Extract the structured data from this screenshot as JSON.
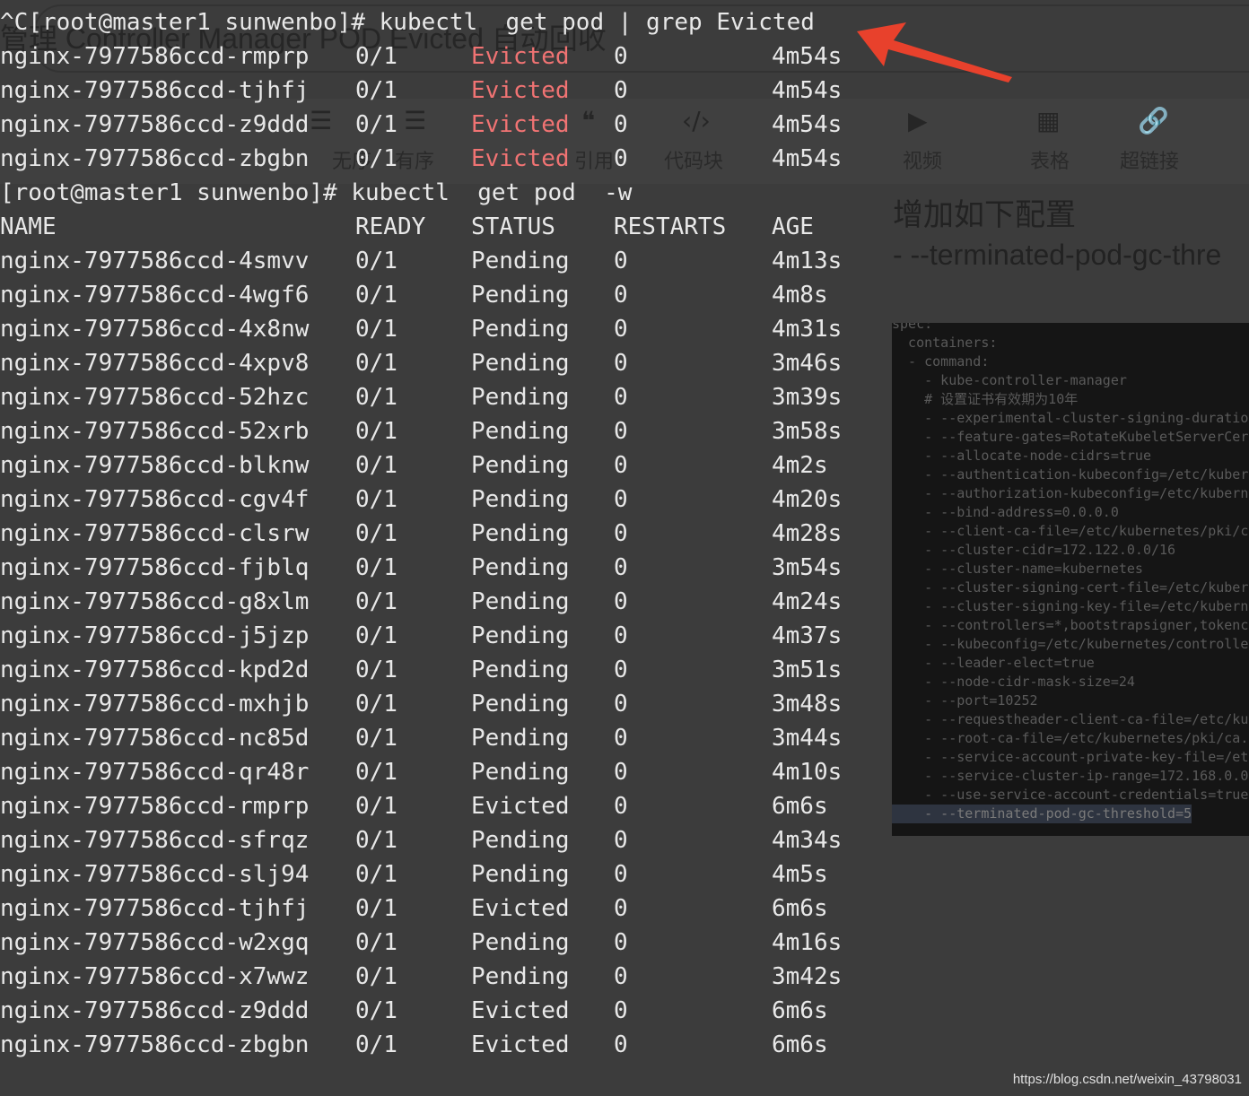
{
  "background": {
    "title": "管理 Controller Manager POD Evicted 自动回收",
    "toolbar": [
      "无序",
      "有序",
      "引用",
      "代码块",
      "视频",
      "表格",
      "超链接"
    ],
    "right_heading": "增加如下配置",
    "right_item": "- --terminated-pod-gc-thre"
  },
  "terminal": {
    "cmd1": "^C[root@master1 sunwenbo]# kubectl  get pod | grep Evicted",
    "grep_rows": [
      [
        "nginx-7977586ccd-rmprp",
        "0/1",
        "Evicted",
        "0",
        "4m54s"
      ],
      [
        "nginx-7977586ccd-tjhfj",
        "0/1",
        "Evicted",
        "0",
        "4m54s"
      ],
      [
        "nginx-7977586ccd-z9ddd",
        "0/1",
        "Evicted",
        "0",
        "4m54s"
      ],
      [
        "nginx-7977586ccd-zbgbn",
        "0/1",
        "Evicted",
        "0",
        "4m54s"
      ]
    ],
    "cmd2": "[root@master1 sunwenbo]# kubectl  get pod  -w",
    "headers": [
      "NAME",
      "READY",
      "STATUS",
      "RESTARTS",
      "AGE"
    ],
    "rows": [
      [
        "nginx-7977586ccd-4smvv",
        "0/1",
        "Pending",
        "0",
        "4m13s"
      ],
      [
        "nginx-7977586ccd-4wgf6",
        "0/1",
        "Pending",
        "0",
        "4m8s"
      ],
      [
        "nginx-7977586ccd-4x8nw",
        "0/1",
        "Pending",
        "0",
        "4m31s"
      ],
      [
        "nginx-7977586ccd-4xpv8",
        "0/1",
        "Pending",
        "0",
        "3m46s"
      ],
      [
        "nginx-7977586ccd-52hzc",
        "0/1",
        "Pending",
        "0",
        "3m39s"
      ],
      [
        "nginx-7977586ccd-52xrb",
        "0/1",
        "Pending",
        "0",
        "3m58s"
      ],
      [
        "nginx-7977586ccd-blknw",
        "0/1",
        "Pending",
        "0",
        "4m2s"
      ],
      [
        "nginx-7977586ccd-cgv4f",
        "0/1",
        "Pending",
        "0",
        "4m20s"
      ],
      [
        "nginx-7977586ccd-clsrw",
        "0/1",
        "Pending",
        "0",
        "4m28s"
      ],
      [
        "nginx-7977586ccd-fjblq",
        "0/1",
        "Pending",
        "0",
        "3m54s"
      ],
      [
        "nginx-7977586ccd-g8xlm",
        "0/1",
        "Pending",
        "0",
        "4m24s"
      ],
      [
        "nginx-7977586ccd-j5jzp",
        "0/1",
        "Pending",
        "0",
        "4m37s"
      ],
      [
        "nginx-7977586ccd-kpd2d",
        "0/1",
        "Pending",
        "0",
        "3m51s"
      ],
      [
        "nginx-7977586ccd-mxhjb",
        "0/1",
        "Pending",
        "0",
        "3m48s"
      ],
      [
        "nginx-7977586ccd-nc85d",
        "0/1",
        "Pending",
        "0",
        "3m44s"
      ],
      [
        "nginx-7977586ccd-qr48r",
        "0/1",
        "Pending",
        "0",
        "4m10s"
      ],
      [
        "nginx-7977586ccd-rmprp",
        "0/1",
        "Evicted",
        "0",
        "6m6s"
      ],
      [
        "nginx-7977586ccd-sfrqz",
        "0/1",
        "Pending",
        "0",
        "4m34s"
      ],
      [
        "nginx-7977586ccd-slj94",
        "0/1",
        "Pending",
        "0",
        "4m5s"
      ],
      [
        "nginx-7977586ccd-tjhfj",
        "0/1",
        "Evicted",
        "0",
        "6m6s"
      ],
      [
        "nginx-7977586ccd-w2xgq",
        "0/1",
        "Pending",
        "0",
        "4m16s"
      ],
      [
        "nginx-7977586ccd-x7wwz",
        "0/1",
        "Pending",
        "0",
        "3m42s"
      ],
      [
        "nginx-7977586ccd-z9ddd",
        "0/1",
        "Evicted",
        "0",
        "6m6s"
      ],
      [
        "nginx-7977586ccd-zbgbn",
        "0/1",
        "Evicted",
        "0",
        "6m6s"
      ]
    ]
  },
  "code_lines": [
    "spec:",
    "  containers:",
    "  - command:",
    "    - kube-controller-manager",
    "    # 设置证书有效期为10年",
    "    - --experimental-cluster-signing-duratio",
    "    - --feature-gates=RotateKubeletServerCer",
    "    - --allocate-node-cidrs=true",
    "    - --authentication-kubeconfig=/etc/kuber",
    "    - --authorization-kubeconfig=/etc/kubern",
    "    - --bind-address=0.0.0.0",
    "    - --client-ca-file=/etc/kubernetes/pki/c",
    "    - --cluster-cidr=172.122.0.0/16",
    "    - --cluster-name=kubernetes",
    "    - --cluster-signing-cert-file=/etc/kuber",
    "    - --cluster-signing-key-file=/etc/kubern",
    "    - --controllers=*,bootstrapsigner,tokenc",
    "    - --kubeconfig=/etc/kubernetes/controlle",
    "    - --leader-elect=true",
    "    - --node-cidr-mask-size=24",
    "    - --port=10252",
    "    - --requestheader-client-ca-file=/etc/ku",
    "    - --root-ca-file=/etc/kubernetes/pki/ca.",
    "    - --service-account-private-key-file=/et",
    "    - --service-cluster-ip-range=172.168.0.0",
    "    - --use-service-account-credentials=true",
    "    - --terminated-pod-gc-threshold=5"
  ],
  "watermark": "https://blog.csdn.net/weixin_43798031",
  "colors": {
    "evicted_highlight": "#f07373",
    "arrow": "#e8412c",
    "terminal_text": "#e8e8e8"
  }
}
